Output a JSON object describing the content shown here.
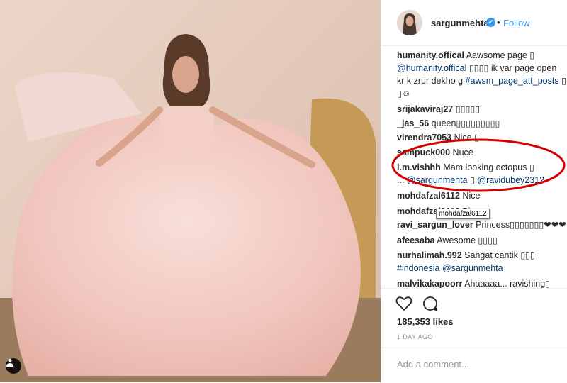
{
  "post": {
    "username": "sargunmehta",
    "verified_mark": "✔",
    "dot": "•",
    "follow": "Follow",
    "likes": "185,353 likes",
    "time": "1 DAY AGO",
    "add_comment_placeholder": "Add a comment..."
  },
  "comments": [
    {
      "user": "humanity.offical",
      "parts": [
        {
          "t": " Aawsome page ▯"
        }
      ]
    },
    {
      "user": "",
      "parts": [
        {
          "t": "@humanity.offical",
          "tag": true
        },
        {
          "t": " ▯▯▯▯ ik var page open"
        }
      ]
    },
    {
      "user": "",
      "parts": [
        {
          "t": "kr k zrur dekho g "
        },
        {
          "t": "#awsm_page_att_posts",
          "tag": true
        },
        {
          "t": " ▯"
        }
      ]
    },
    {
      "user": "",
      "parts": [
        {
          "t": "▯☺"
        }
      ]
    },
    {
      "user": "srijakaviraj27",
      "parts": [
        {
          "t": " ▯▯▯▯▯"
        }
      ]
    },
    {
      "user": "_jas_56",
      "parts": [
        {
          "t": " queen▯▯▯▯▯▯▯▯▯"
        }
      ]
    },
    {
      "user": "virendra7053",
      "parts": [
        {
          "t": " Nice ▯"
        }
      ]
    },
    {
      "user": "sampuck000",
      "parts": [
        {
          "t": " Nuce"
        }
      ]
    },
    {
      "user": "i.m.vishhh",
      "parts": [
        {
          "t": " Mam looking octopus ▯"
        }
      ]
    },
    {
      "user": "",
      "parts": [
        {
          "t": "... "
        },
        {
          "t": "@sargunmehta",
          "tag": true
        },
        {
          "t": " ▯ "
        },
        {
          "t": "@ravidubey2312",
          "tag": true
        }
      ]
    },
    {
      "user": "mohdafzal6112",
      "parts": [
        {
          "t": " Nice"
        }
      ]
    },
    {
      "user": "mohdafzal6112",
      "parts": [
        {
          "t": " Bic"
        }
      ]
    },
    {
      "user": "ravi_sargun_lover",
      "parts": [
        {
          "t": " Princess▯▯▯▯▯▯▯❤❤❤"
        }
      ]
    },
    {
      "user": "afeesaba",
      "parts": [
        {
          "t": " Awesome ▯▯▯▯"
        }
      ]
    },
    {
      "user": "nurhalimah.992",
      "parts": [
        {
          "t": " Sangat cantik ▯▯▯"
        }
      ]
    },
    {
      "user": "",
      "parts": [
        {
          "t": "#indonesia",
          "tag": true
        },
        {
          "t": " "
        },
        {
          "t": "@sargunmehta",
          "tag": true
        }
      ]
    },
    {
      "user": "malvikakapoorr",
      "parts": [
        {
          "t": " Ahaaaaa... ravishing▯"
        }
      ]
    }
  ],
  "tooltip": "mohdafzal6112",
  "icons": {
    "like": "heart-icon",
    "comment": "comment-icon",
    "user_tag": "user-tag-icon"
  },
  "colors": {
    "link": "#3897f0",
    "tag": "#003569",
    "annotation": "#d40000"
  }
}
